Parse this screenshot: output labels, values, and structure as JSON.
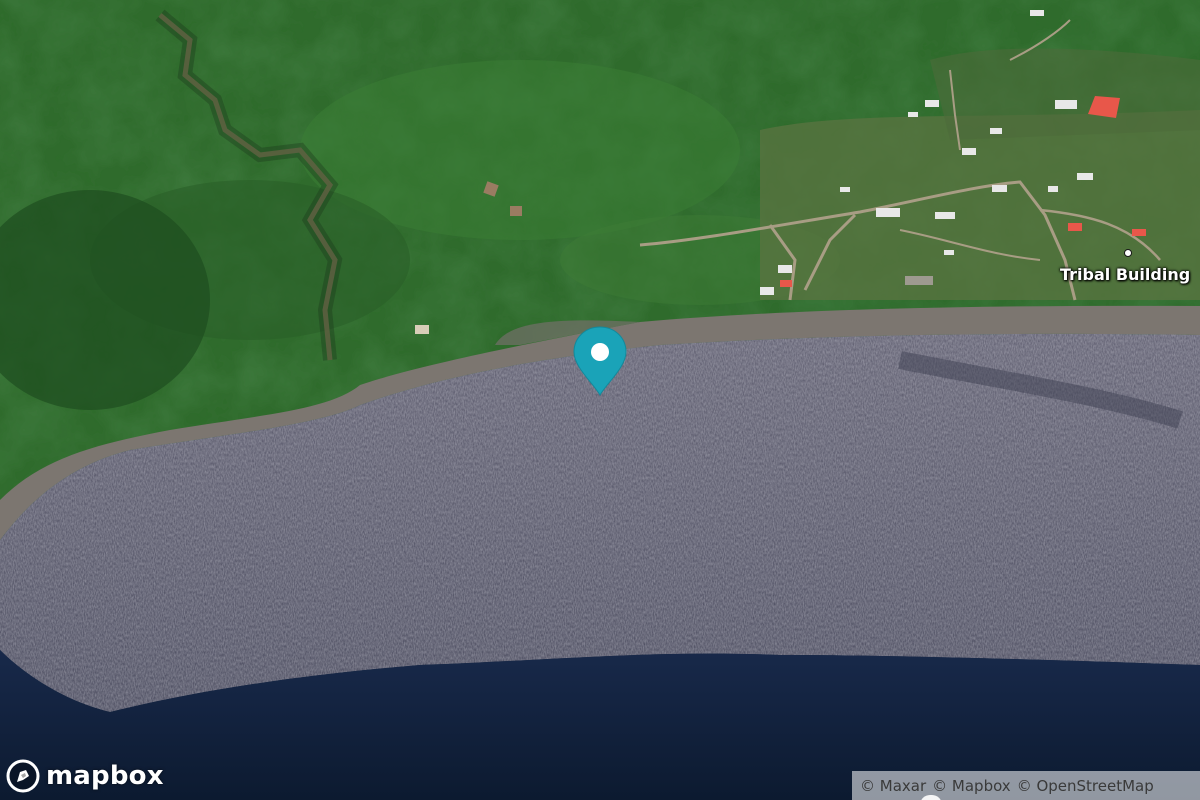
{
  "map": {
    "poi": {
      "label": "Tribal Building"
    },
    "marker": {
      "icon": "location-pin-icon",
      "color": "#1aa3b8"
    },
    "colors": {
      "forest": "#2f6b2c",
      "forest_dark": "#1d4a1e",
      "clearing": "#5b7442",
      "beach": "#7c7670",
      "surf": "#5e5c6e",
      "deep_water": "#12223d",
      "roof_red": "#e8574a"
    }
  },
  "logo": {
    "text": "mapbox",
    "icon": "mapbox-logo-icon"
  },
  "attribution": {
    "items": [
      "© Maxar",
      "© Mapbox",
      "© OpenStreetMap"
    ]
  }
}
